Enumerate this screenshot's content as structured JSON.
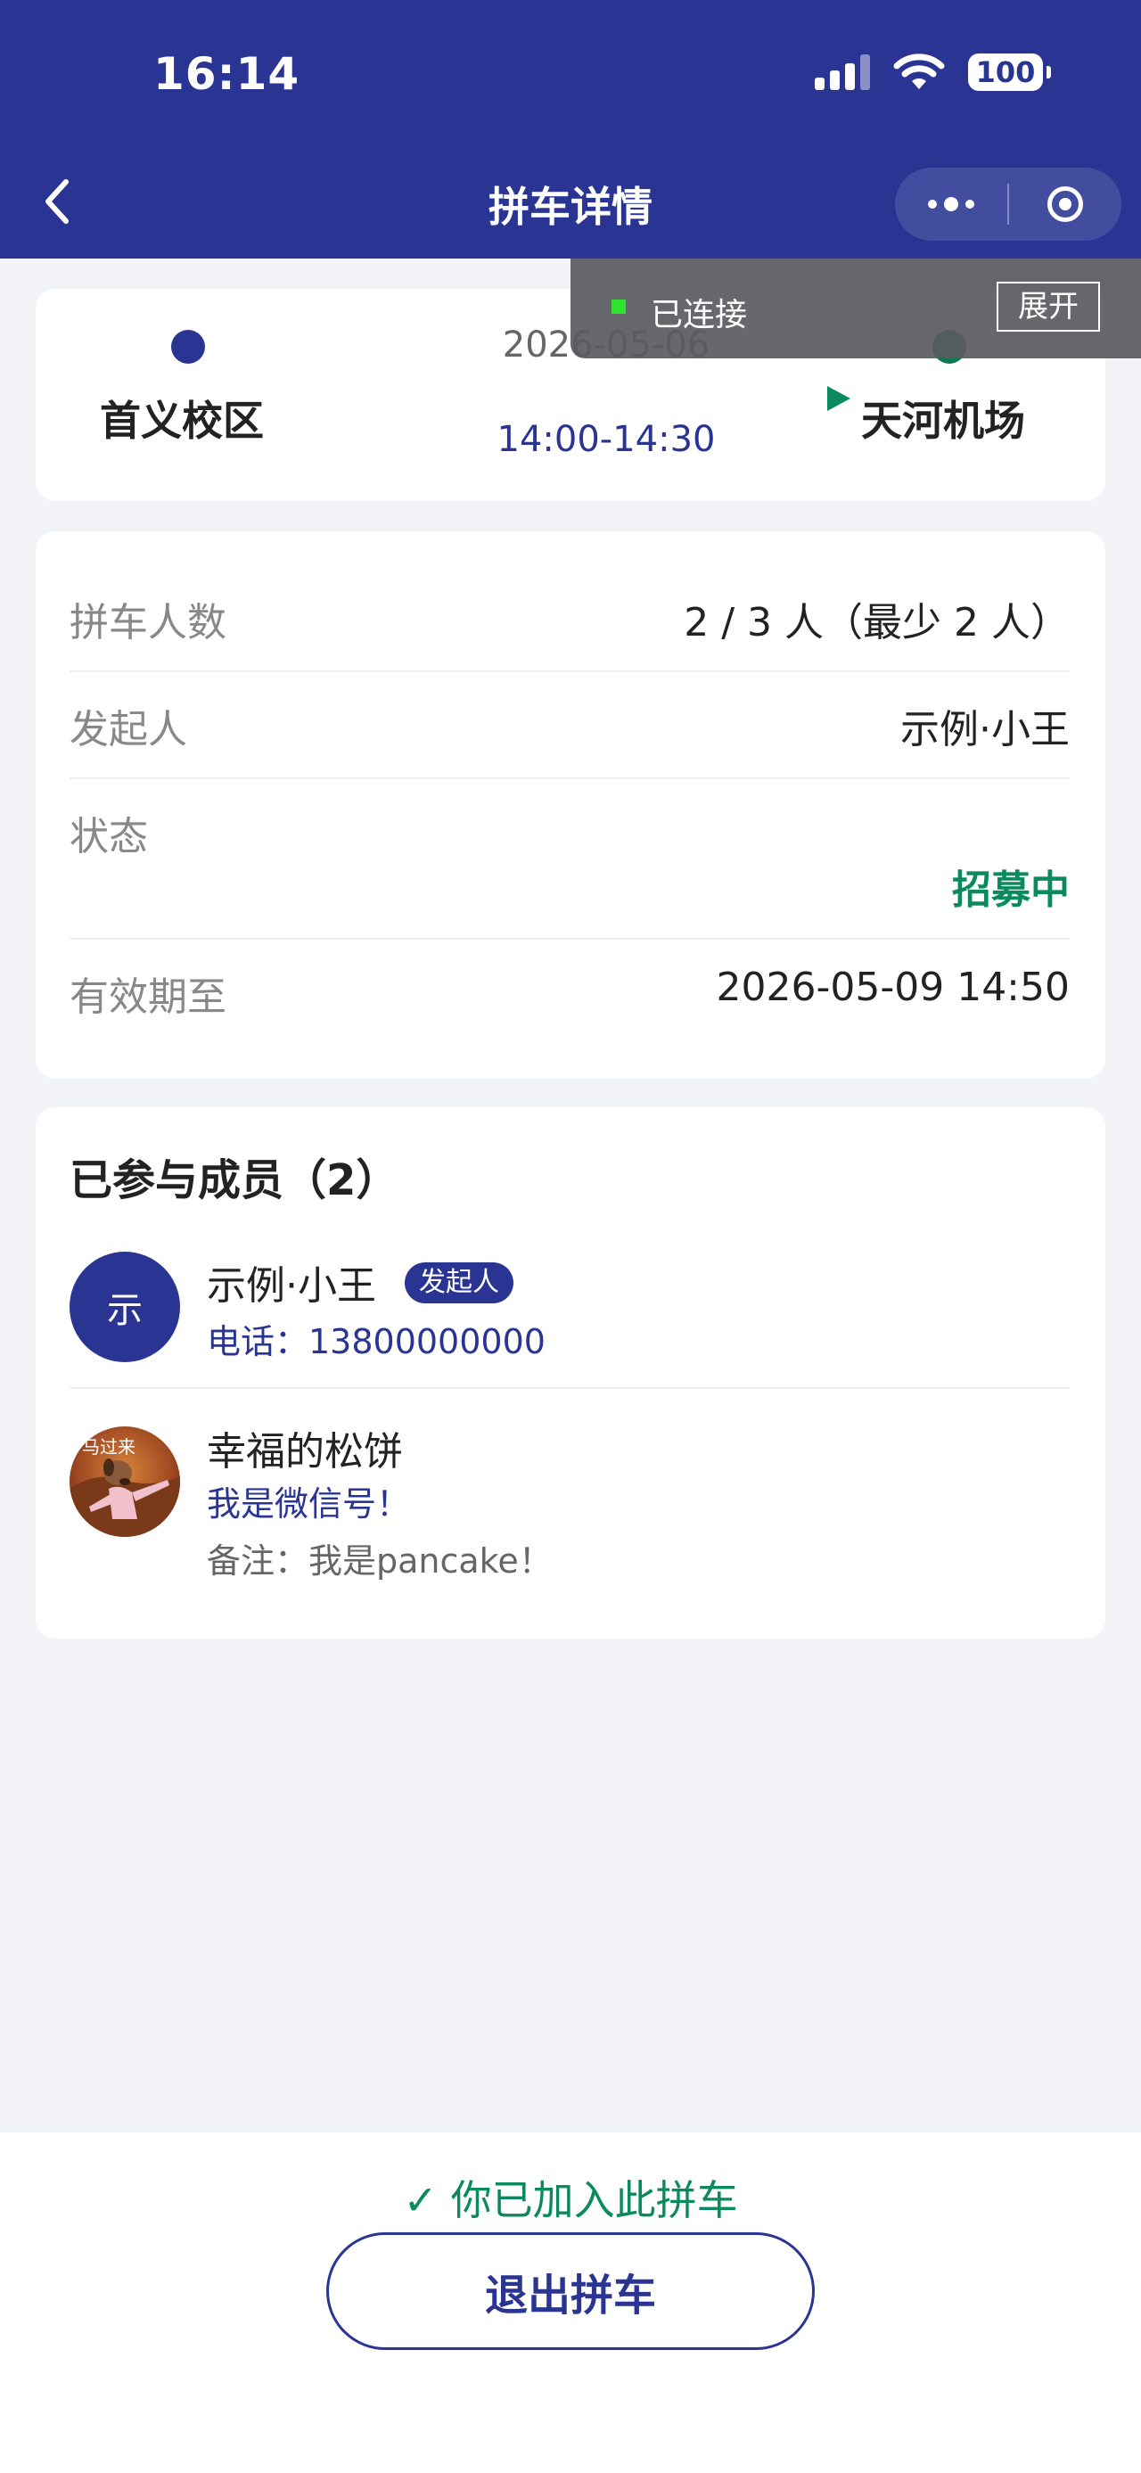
{
  "status_bar": {
    "time": "16:14",
    "battery": "100"
  },
  "nav": {
    "title": "拼车详情"
  },
  "route": {
    "from": "首义校区",
    "to": "天河机场",
    "date": "2026-05-06",
    "time_range": "14:00-14:30"
  },
  "info": {
    "rows": [
      {
        "label": "拼车人数",
        "value": "2 / 3 人（最少 2 人）"
      },
      {
        "label": "发起人",
        "value": "示例·小王"
      },
      {
        "label": "状态",
        "value": "招募中"
      },
      {
        "label": "有效期至",
        "value": "2026-05-09 14:50"
      }
    ]
  },
  "members": {
    "title": "已参与成员（2）",
    "list": [
      {
        "avatar_text": "示",
        "name": "示例·小王",
        "badge": "发起人",
        "contact": "电话：13800000000"
      },
      {
        "name": "幸福的松饼",
        "contact": "我是微信号！",
        "note": "备注：我是pancake！",
        "avatar_caption": "马过来"
      }
    ]
  },
  "footer": {
    "joined_text": "✓ 你已加入此拼车",
    "exit_label": "退出拼车"
  },
  "connection": {
    "status": "已连接",
    "expand_label": "展开"
  },
  "colors": {
    "primary": "#2a3593",
    "success": "#0c8a5f",
    "background": "#f3f4f8"
  }
}
